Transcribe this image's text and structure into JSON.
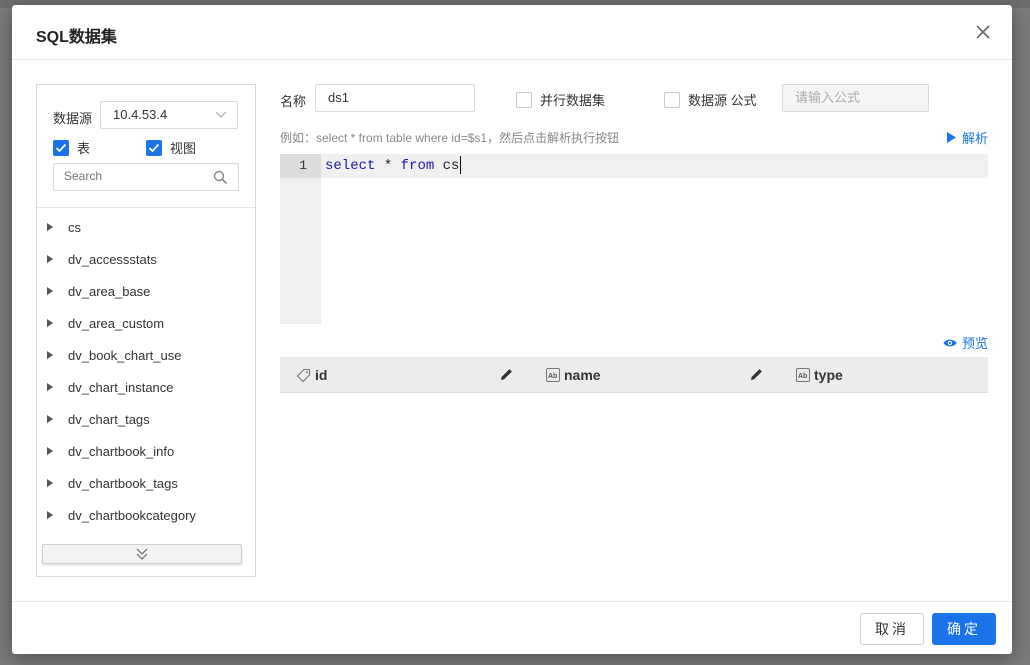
{
  "dialog": {
    "title": "SQL数据集"
  },
  "datasource": {
    "label": "数据源",
    "selected": "10.4.53.4",
    "show_tables_label": "表",
    "show_tables_checked": true,
    "show_views_label": "视图",
    "show_views_checked": true,
    "search_placeholder": "Search"
  },
  "tables": [
    "cs",
    "dv_accessstats",
    "dv_area_base",
    "dv_area_custom",
    "dv_book_chart_use",
    "dv_chart_instance",
    "dv_chart_tags",
    "dv_chartbook_info",
    "dv_chartbook_tags",
    "dv_chartbookcategory"
  ],
  "form": {
    "name_label": "名称",
    "name_value": "ds1",
    "parallel_label": "并行数据集",
    "parallel_checked": false,
    "formula_label": "数据源 公式",
    "formula_checked": false,
    "formula_placeholder": "请输入公式"
  },
  "editor": {
    "hint": "例如：select * from table where id=$s1，然后点击解析执行按钮",
    "parse_label": "解析",
    "line_number": "1",
    "code_tokens": [
      "select",
      " * ",
      "from",
      " cs"
    ]
  },
  "preview": {
    "label": "预览"
  },
  "columns": [
    {
      "name": "id",
      "icon": "tag-icon"
    },
    {
      "name": "name",
      "icon": "text-type-icon"
    },
    {
      "name": "type",
      "icon": "text-type-icon"
    }
  ],
  "footer": {
    "cancel_label": "取消",
    "ok_label": "确定"
  },
  "colors": {
    "accent": "#1a73e8"
  }
}
